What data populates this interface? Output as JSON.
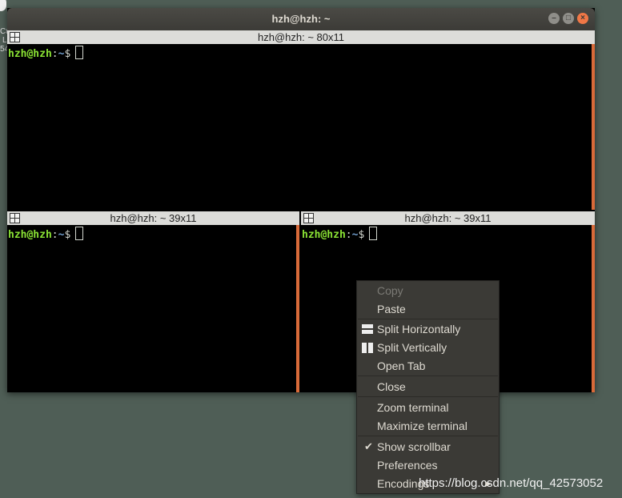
{
  "desktop": {
    "edge_lines": [
      "Cu",
      "L",
      "54"
    ]
  },
  "window": {
    "title": "hzh@hzh: ~",
    "controls": [
      "minimize",
      "maximize",
      "close"
    ]
  },
  "panes": [
    {
      "header": "hzh@hzh: ~ 80x11",
      "prompt_user": "hzh@hzh",
      "prompt_sep": ":",
      "prompt_path": "~",
      "prompt_sym": "$"
    },
    {
      "header": "hzh@hzh: ~ 39x11",
      "prompt_user": "hzh@hzh",
      "prompt_sep": ":",
      "prompt_path": "~",
      "prompt_sym": "$"
    },
    {
      "header": "hzh@hzh: ~ 39x11",
      "prompt_user": "hzh@hzh",
      "prompt_sep": ":",
      "prompt_path": "~",
      "prompt_sym": "$"
    }
  ],
  "context_menu": {
    "items": [
      {
        "label": "Copy",
        "enabled": false
      },
      {
        "label": "Paste"
      },
      {
        "label": "Split Horizontally",
        "icon": "split-horizontal-icon"
      },
      {
        "label": "Split Vertically",
        "icon": "split-vertical-icon"
      },
      {
        "label": "Open Tab"
      },
      {
        "label": "Close"
      },
      {
        "label": "Zoom terminal"
      },
      {
        "label": "Maximize terminal"
      },
      {
        "label": "Show scrollbar",
        "checked": true
      },
      {
        "label": "Preferences"
      },
      {
        "label": "Encodings",
        "submenu": true
      }
    ]
  },
  "watermark": "https://blog.csdn.net/qq_42573052",
  "colors": {
    "desktop": "#4f5e56",
    "titlebar": "#3c3b37",
    "prompt_user": "#8ae234",
    "prompt_path": "#729fcf",
    "scrollbar": "#d86a39",
    "menu_bg": "#3b3a36"
  }
}
